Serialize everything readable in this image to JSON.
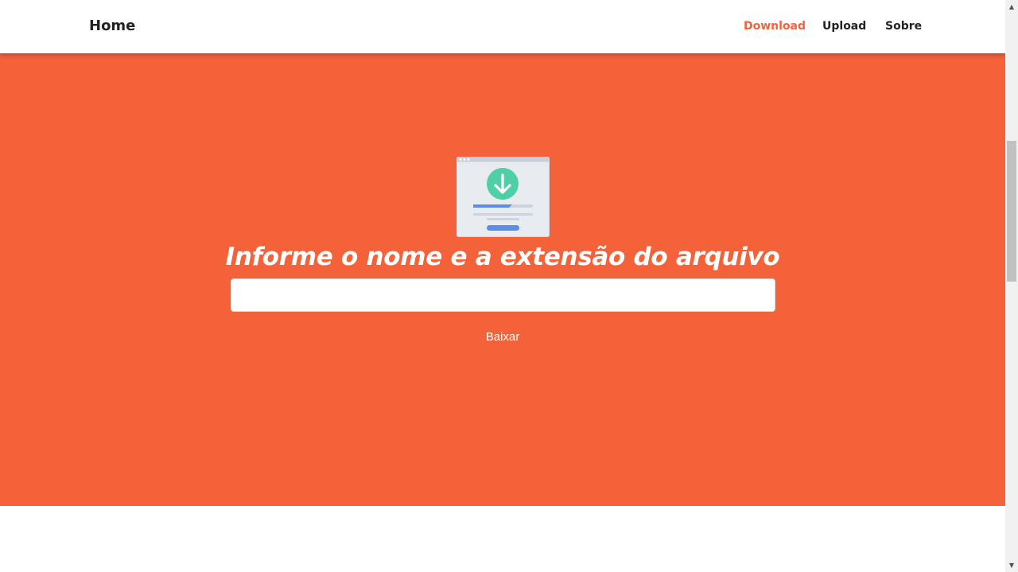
{
  "navbar": {
    "brand": "Home",
    "links": [
      {
        "label": "Download",
        "active": true
      },
      {
        "label": "Upload",
        "active": false
      },
      {
        "label": "Sobre",
        "active": false
      }
    ]
  },
  "hero": {
    "headline": "Informe o nome e a extensão do arquivo",
    "input": {
      "value": "",
      "placeholder": ""
    },
    "button_label": "Baixar",
    "illustration_icon": "download-page-icon"
  },
  "colors": {
    "accent": "#f4623a",
    "download_circle": "#4fcfa6",
    "progress_blue": "#5b8ee6"
  }
}
